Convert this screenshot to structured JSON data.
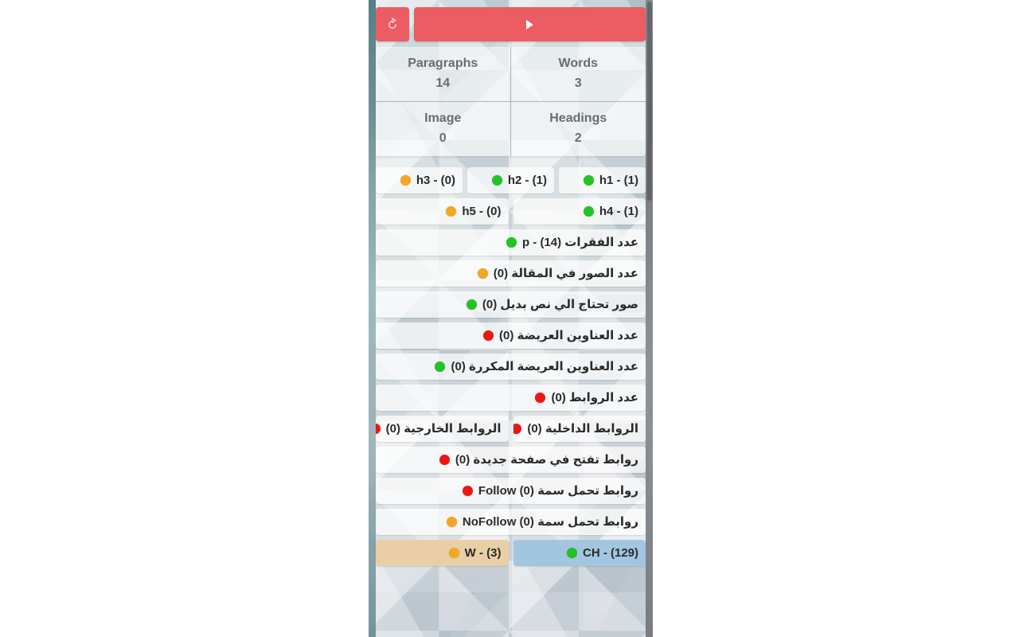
{
  "toolbar": {
    "refresh_icon": "refresh-icon",
    "run_icon": "play-icon",
    "bar_color": "#eb5d62"
  },
  "stats": [
    {
      "label": "Paragraphs",
      "value": "14"
    },
    {
      "label": "Words",
      "value": "3"
    },
    {
      "label": "Image",
      "value": "0"
    },
    {
      "label": "Headings",
      "value": "2"
    }
  ],
  "headings_row1": [
    {
      "label": "h3 - (0)",
      "status": "orange"
    },
    {
      "label": "h2 - (1)",
      "status": "green"
    },
    {
      "label": "h1 - (1)",
      "status": "green"
    }
  ],
  "headings_row2": [
    {
      "label": "h5 - (0)",
      "status": "orange"
    },
    {
      "label": "h4 - (1)",
      "status": "green"
    }
  ],
  "metrics": [
    {
      "label": "عدد الفقرات (14) - p",
      "status": "green"
    },
    {
      "label": "عدد الصور في المقالة (0)",
      "status": "orange"
    },
    {
      "label": "صور تحتاج الي نص بديل (0)",
      "status": "green"
    },
    {
      "label": "عدد العناوين العريضة (0)",
      "status": "red"
    },
    {
      "label": "عدد العناوين العريضة المكررة (0)",
      "status": "green"
    },
    {
      "label": "عدد الروابط (0)",
      "status": "red"
    },
    {
      "label": "روابط تفتح في صفحة جديدة (0)",
      "status": "red"
    },
    {
      "label": "روابط تحمل سمة Follow (0)",
      "status": "red"
    },
    {
      "label": "روابط تحمل سمة NoFollow (0)",
      "status": "orange"
    }
  ],
  "links_split": [
    {
      "label": "الروابط الخارجية (0)",
      "status": "red"
    },
    {
      "label": "الروابط الداخلية (0)",
      "status": "red"
    }
  ],
  "counters": [
    {
      "label": "W - (3)",
      "status": "orange",
      "background": "#e8cfa6"
    },
    {
      "label": "CH - (129)",
      "status": "green",
      "background": "#a3c6e0"
    }
  ],
  "status_colors": {
    "green": "#22c322",
    "orange": "#f5a623",
    "red": "#ee1612"
  }
}
